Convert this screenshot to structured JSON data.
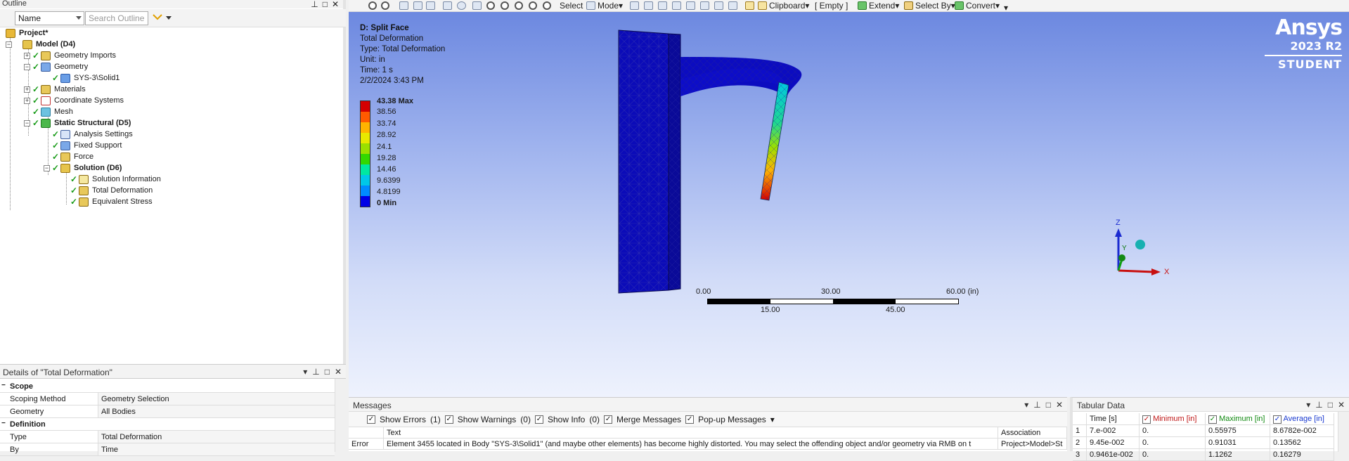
{
  "outline": {
    "title": "Outline",
    "filter_select": "Name",
    "search_placeholder": "Search Outline",
    "tree": [
      {
        "label": "Project*",
        "bold": true
      },
      {
        "label": "Model (D4)",
        "bold": true
      },
      {
        "label": "Geometry Imports"
      },
      {
        "label": "Geometry"
      },
      {
        "label": "SYS-3\\Solid1"
      },
      {
        "label": "Materials"
      },
      {
        "label": "Coordinate Systems"
      },
      {
        "label": "Mesh"
      },
      {
        "label": "Static Structural (D5)",
        "bold": true
      },
      {
        "label": "Analysis Settings"
      },
      {
        "label": "Fixed Support"
      },
      {
        "label": "Force"
      },
      {
        "label": "Solution (D6)",
        "bold": true
      },
      {
        "label": "Solution Information"
      },
      {
        "label": "Total Deformation"
      },
      {
        "label": "Equivalent Stress"
      }
    ]
  },
  "details": {
    "title": "Details of \"Total Deformation\"",
    "sections": [
      {
        "name": "Scope",
        "rows": [
          {
            "key": "Scoping Method",
            "value": "Geometry Selection"
          },
          {
            "key": "Geometry",
            "value": "All Bodies"
          }
        ]
      },
      {
        "name": "Definition",
        "rows": [
          {
            "key": "Type",
            "value": "Total Deformation"
          },
          {
            "key": "By",
            "value": "Time"
          }
        ]
      }
    ]
  },
  "toolbar": {
    "select": "Select",
    "mode": "Mode",
    "clipboard": "Clipboard",
    "empty": "[ Empty ]",
    "extend": "Extend",
    "select_by": "Select By",
    "convert": "Convert"
  },
  "viewport": {
    "info": {
      "title": "D: Split Face",
      "lines": [
        "Total Deformation",
        "Type: Total Deformation",
        "Unit: in",
        "Time: 1 s",
        "2/2/2024 3:43 PM"
      ]
    },
    "legend": {
      "labels": [
        "43.38 Max",
        "38.56",
        "33.74",
        "28.92",
        "24.1",
        "19.28",
        "14.46",
        "9.6399",
        "4.8199",
        "0 Min"
      ],
      "colors": [
        "#d40000",
        "#ff5a00",
        "#ffb400",
        "#e8e800",
        "#9be000",
        "#33d800",
        "#00e8a0",
        "#00c8e8",
        "#008cff",
        "#0000e6"
      ]
    },
    "brand": {
      "name": "Ansys",
      "version": "2023 R2",
      "edition": "STUDENT"
    },
    "scale": {
      "top": [
        "0.00",
        "30.00",
        "60.00 (in)"
      ],
      "bottom": [
        "15.00",
        "45.00"
      ]
    },
    "axes": {
      "z": "Z",
      "y": "Y",
      "x": "X"
    }
  },
  "messages": {
    "title": "Messages",
    "show_errors": "Show Errors",
    "errors_count": "(1)",
    "show_warnings": "Show Warnings",
    "warnings_count": "(0)",
    "show_info": "Show Info",
    "info_count": "(0)",
    "merge": "Merge Messages",
    "popup": "Pop-up Messages",
    "columns": [
      "Text",
      "Association"
    ],
    "rows": [
      {
        "type": "Error",
        "text": "Element 3455 located in Body \"SYS-3\\Solid1\" (and maybe other elements) has become highly distorted.  You may select the offending object and/or geometry via RMB on t",
        "assoc": "Project>Model>St"
      }
    ]
  },
  "tabular": {
    "title": "Tabular Data",
    "columns": [
      "Time [s]",
      "Minimum [in]",
      "Maximum [in]",
      "Average [in]"
    ],
    "rows": [
      {
        "n": "1",
        "time": "7.e-002",
        "min": "0.",
        "max": "0.55975",
        "avg": "8.6782e-002"
      },
      {
        "n": "2",
        "time": "9.45e-002",
        "min": "0.",
        "max": "0.91031",
        "avg": "0.13562"
      },
      {
        "n": "3",
        "time": "0.9461e-002",
        "min": "0.",
        "max": "1.1262",
        "avg": "0.16279"
      }
    ]
  }
}
